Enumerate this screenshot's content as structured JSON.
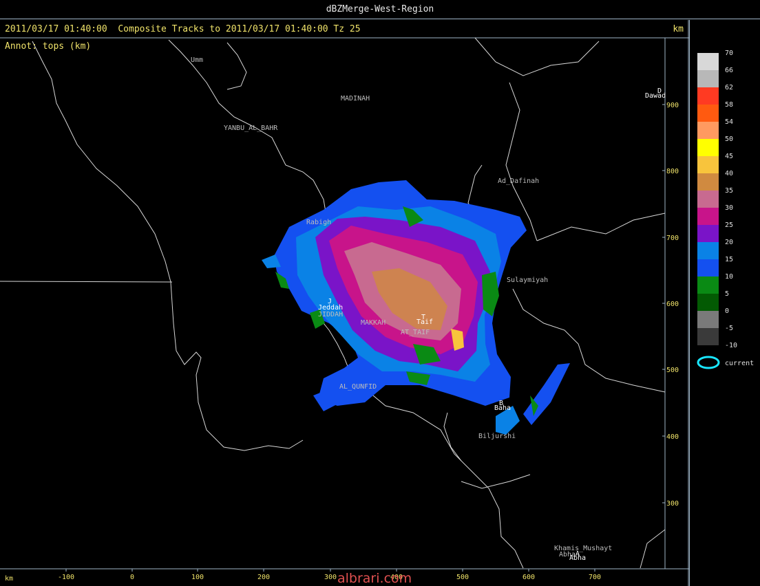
{
  "window": {
    "title": "dBZMerge-West-Region"
  },
  "header": {
    "text": "2011/03/17 01:40:00  Composite Tracks to 2011/03/17 01:40:00 Tz 25",
    "unit": "km"
  },
  "annotation": "Annot: tops (km)",
  "axes": {
    "x_unit": "km",
    "x_ticks": [
      "-100",
      "0",
      "100",
      "200",
      "300",
      "400",
      "500",
      "600",
      "700"
    ],
    "y_ticks": [
      "900",
      "800",
      "700",
      "600",
      "500",
      "400",
      "300"
    ]
  },
  "places": {
    "umm": "Umm",
    "madinah": "MADINAH",
    "yanbu": "YANBU_AL_BAHR",
    "ad_dafinah": "Ad_Dafinah",
    "rabigh": "Rabigh",
    "sulaymiyah": "Sulaymiyah",
    "jeddah": "Jeddah",
    "jeddah_alt": "JIDDAH",
    "makkah": "MAKKAH",
    "taif": "Taif",
    "at_taif": "AT_TAIF",
    "al_qunfudah": "AL_QUNFID",
    "baha": "Baha",
    "biljurshi": "Biljurshi",
    "khamis": "Khamis_Mushayt",
    "abha": "Abha",
    "abha_dup": "Abha",
    "dawadmi": "Dawad",
    "radar_jeddah": "J",
    "radar_taif": "T",
    "radar_baha": "B",
    "radar_abha": "A",
    "radar_dawadmi": "D"
  },
  "legend": {
    "items": [
      {
        "label": "70",
        "color": "#d8d8d8"
      },
      {
        "label": "66",
        "color": "#b8b8b8"
      },
      {
        "label": "62",
        "color": "#ff3a22"
      },
      {
        "label": "58",
        "color": "#ff5a10"
      },
      {
        "label": "54",
        "color": "#ff9a60"
      },
      {
        "label": "50",
        "color": "#ffff00"
      },
      {
        "label": "45",
        "color": "#f8c43c"
      },
      {
        "label": "40",
        "color": "#d08a40"
      },
      {
        "label": "35",
        "color": "#c86a90"
      },
      {
        "label": "30",
        "color": "#c8148a"
      },
      {
        "label": "25",
        "color": "#7a14c8"
      },
      {
        "label": "20",
        "color": "#0a82e6"
      },
      {
        "label": "15",
        "color": "#1450f0"
      },
      {
        "label": "10",
        "color": "#0a8a14"
      },
      {
        "label": "5",
        "color": "#035a03"
      },
      {
        "label": "0",
        "color": "#7a7a7a"
      },
      {
        "label": "-5",
        "color": "#3a3a3a"
      },
      {
        "label": "-10",
        "color": ""
      }
    ],
    "current_label": "current",
    "current_color": "#19e6ff"
  },
  "watermark": "albrari.com"
}
